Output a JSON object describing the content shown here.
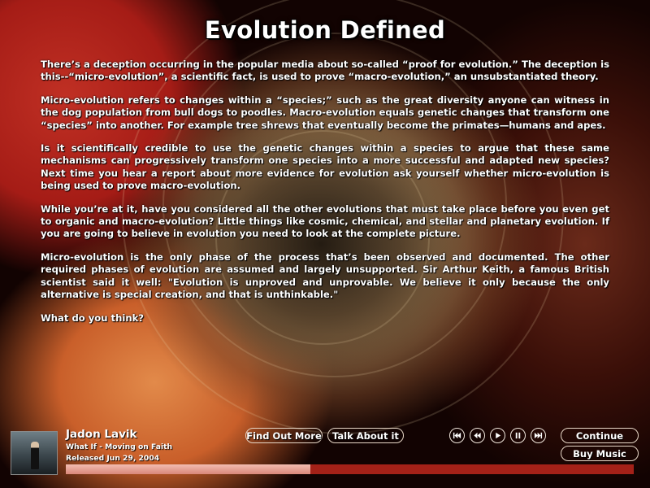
{
  "page": {
    "title": "Evolution Defined",
    "paragraphs": [
      "There’s a deception occurring in the popular media about so-called “proof for evolution.” The deception is this--“micro-evolution”, a scientific fact, is used to prove “macro-evolution,” an unsubstantiated theory.",
      "Micro-evolution refers to changes within a “species;” such as the great diversity anyone can witness in the dog population from bull dogs to poodles. Macro-evolution equals genetic changes that transform one “species” into another. For example tree shrews that eventually become the primates—humans and apes.",
      "Is it scientifically credible to use the genetic changes within a species to argue that these same mechanisms can progressively transform one species into a more successful and adapted new species? Next time you hear a report about more evidence for evolution ask yourself whether micro-evolution is being used to prove macro-evolution.",
      "While you’re at it, have you considered all the other evolutions that must take place before you even get to organic and macro-evolution? Little things like cosmic, chemical, and stellar and planetary evolution. If you are going to believe in evolution you need to look at the complete picture.",
      "Micro-evolution is the only phase of the process that’s been observed and documented. The other required phases of evolution are assumed and largely unsupported. Sir Arthur Keith, a famous British scientist said it well: \"Evolution is unproved and unprovable. We believe it only because the only alternative is special creation, and that is unthinkable.\"",
      "What do you think?"
    ]
  },
  "player": {
    "artist": "Jadon Lavik",
    "album": "What If - Moving on Faith",
    "released": "Released Jun 29, 2004",
    "progress": 0.43,
    "buttons": {
      "find_out_more": "Find Out More",
      "talk_about_it": "Talk About it",
      "continue": "Continue",
      "buy_music": "Buy Music"
    },
    "controls": {
      "icons": [
        "skip-back-icon",
        "rewind-icon",
        "play-icon",
        "pause-icon",
        "skip-forward-icon"
      ]
    }
  },
  "colors": {
    "progress_track": "#a42118",
    "progress_fill": "#e8a597",
    "button_border": "#e8d8c8"
  }
}
